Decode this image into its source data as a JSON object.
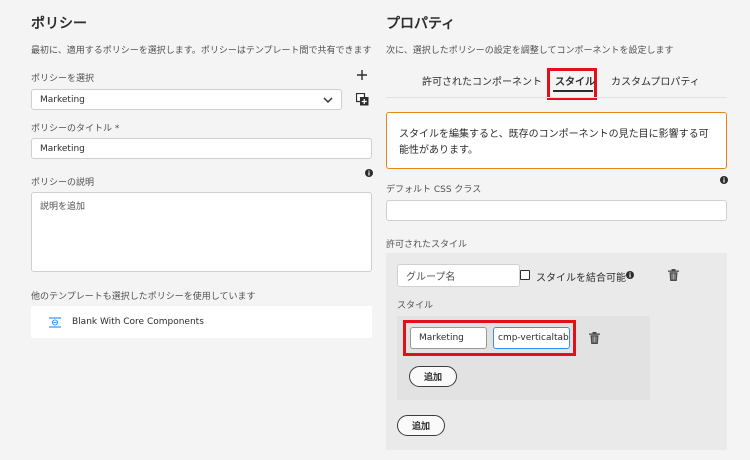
{
  "policy": {
    "heading": "ポリシー",
    "description": "最初に、適用するポリシーを選択します。ポリシーはテンプレート間で共有できます",
    "select_label": "ポリシーを選択",
    "select_value": "Marketing",
    "title_label": "ポリシーのタイトル *",
    "title_value": "Marketing",
    "desc_label": "ポリシーの説明",
    "desc_placeholder": "説明を追加",
    "shared_note": "他のテンプレートも選択したポリシーを使用しています",
    "shared_template": "Blank With Core Components"
  },
  "properties": {
    "heading": "プロパティ",
    "description": "次に、選択したポリシーの設定を調整してコンポーネントを設定します",
    "tabs": [
      {
        "label": "許可されたコンポーネント",
        "active": false
      },
      {
        "label": "スタイル",
        "active": true
      },
      {
        "label": "カスタムプロパティ",
        "active": false
      }
    ],
    "warning": "スタイルを編集すると、既存のコンポーネントの見た目に影響する可能性があります。",
    "default_css_label": "デフォルト CSS クラス",
    "default_css_value": "",
    "allowed_styles_label": "許可されたスタイル",
    "group_name_placeholder": "グループ名",
    "combine_label": "スタイルを結合可能",
    "styles_label": "スタイル",
    "style_name_value": "Marketing",
    "style_class_value": "cmp-verticaltabs",
    "add_inner": "追加",
    "add_outer": "追加"
  },
  "colors": {
    "warning_border": "#e68619",
    "highlight": "#e0111b",
    "field_focus": "#378ef0"
  }
}
